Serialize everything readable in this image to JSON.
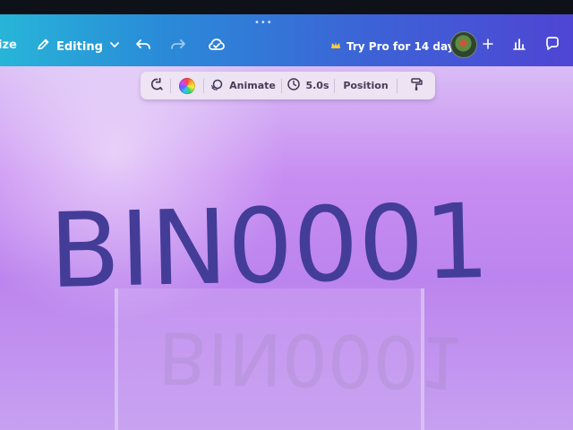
{
  "header": {
    "left_partial_label": "ize",
    "mode_label": "Editing",
    "pro_label": "Try Pro for 14 days"
  },
  "toolbar": {
    "animate_label": "Animate",
    "duration_label": "5.0s",
    "position_label": "Position"
  },
  "canvas": {
    "main_text": "BIN0001",
    "reflection_text": "BIN0001"
  },
  "colors": {
    "header_start": "#27b5d8",
    "header_end": "#4f45d4",
    "canvas_purple": "#c88df2",
    "main_text_color": "#443d98"
  },
  "icons": [
    "drag-handle-icon",
    "pencil-icon",
    "chevron-down-icon",
    "undo-icon",
    "redo-icon",
    "cloud-check-icon",
    "crown-icon",
    "plus-icon",
    "analytics-icon",
    "comment-icon",
    "replace-shape-icon",
    "color-wheel-icon",
    "animate-icon",
    "clock-icon",
    "paint-roller-icon"
  ]
}
